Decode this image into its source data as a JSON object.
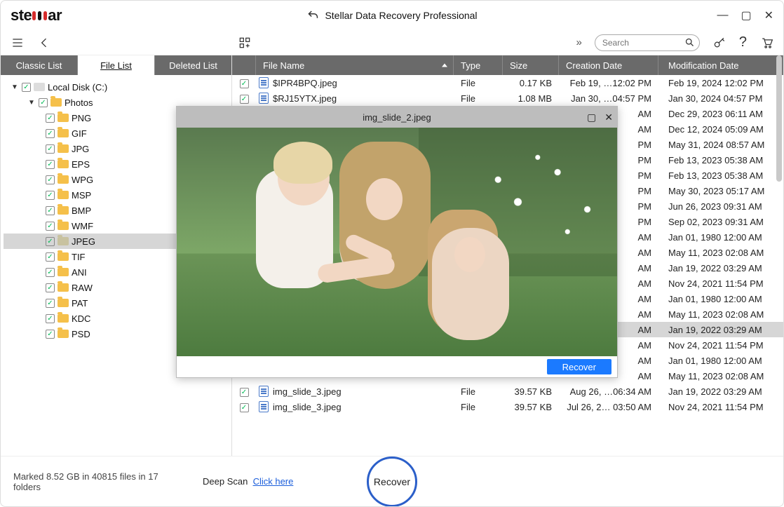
{
  "app": {
    "name_prefix": "ste",
    "name_suffix": "ar",
    "title": "Stellar Data Recovery Professional"
  },
  "win_controls": {
    "min": "—",
    "max": "▢",
    "close": "✕"
  },
  "toolbar": {
    "grid_icon": "grid-icon",
    "arrows_icon": "»"
  },
  "search": {
    "placeholder": "Search"
  },
  "side_tabs": {
    "classic": "Classic List",
    "file": "File List",
    "deleted": "Deleted List"
  },
  "tree": {
    "root": {
      "label": "Local Disk (C:)"
    },
    "photos": {
      "label": "Photos"
    },
    "items": [
      {
        "label": "PNG"
      },
      {
        "label": "GIF"
      },
      {
        "label": "JPG"
      },
      {
        "label": "EPS"
      },
      {
        "label": "WPG"
      },
      {
        "label": "MSP"
      },
      {
        "label": "BMP"
      },
      {
        "label": "WMF"
      },
      {
        "label": "JPEG",
        "selected": true
      },
      {
        "label": "TIF"
      },
      {
        "label": "ANI"
      },
      {
        "label": "RAW"
      },
      {
        "label": "PAT"
      },
      {
        "label": "KDC"
      },
      {
        "label": "PSD"
      }
    ]
  },
  "columns": {
    "name": "File Name",
    "type": "Type",
    "size": "Size",
    "created": "Creation Date",
    "modified": "Modification Date"
  },
  "files": [
    {
      "name": "$IPR4BPQ.jpeg",
      "type": "File",
      "size": "0.17 KB",
      "created": "Feb 19, …12:02 PM",
      "modified": "Feb 19, 2024 12:02 PM"
    },
    {
      "name": "$RJ15YTX.jpeg",
      "type": "File",
      "size": "1.08 MB",
      "created": "Jan 30, …04:57 PM",
      "modified": "Jan 30, 2024 04:57 PM"
    },
    {
      "name": "",
      "type": "",
      "size": "",
      "created": "AM",
      "modified": "Dec 29, 2023 06:11 AM"
    },
    {
      "name": "",
      "type": "",
      "size": "",
      "created": "AM",
      "modified": "Dec 12, 2024 05:09 AM"
    },
    {
      "name": "",
      "type": "",
      "size": "",
      "created": "PM",
      "modified": "May 31, 2024 08:57 AM"
    },
    {
      "name": "",
      "type": "",
      "size": "",
      "created": "PM",
      "modified": "Feb 13, 2023 05:38 AM"
    },
    {
      "name": "",
      "type": "",
      "size": "",
      "created": "PM",
      "modified": "Feb 13, 2023 05:38 AM"
    },
    {
      "name": "",
      "type": "",
      "size": "",
      "created": "PM",
      "modified": "May 30, 2023 05:17 AM"
    },
    {
      "name": "",
      "type": "",
      "size": "",
      "created": "PM",
      "modified": "Jun 26, 2023 09:31 AM"
    },
    {
      "name": "",
      "type": "",
      "size": "",
      "created": "PM",
      "modified": "Sep 02, 2023 09:31 AM"
    },
    {
      "name": "",
      "type": "",
      "size": "",
      "created": "AM",
      "modified": "Jan 01, 1980 12:00 AM"
    },
    {
      "name": "",
      "type": "",
      "size": "",
      "created": "AM",
      "modified": "May 11, 2023 02:08 AM"
    },
    {
      "name": "",
      "type": "",
      "size": "",
      "created": "AM",
      "modified": "Jan 19, 2022 03:29 AM"
    },
    {
      "name": "",
      "type": "",
      "size": "",
      "created": "AM",
      "modified": "Nov 24, 2021 11:54 PM"
    },
    {
      "name": "",
      "type": "",
      "size": "",
      "created": "AM",
      "modified": "Jan 01, 1980 12:00 AM"
    },
    {
      "name": "",
      "type": "",
      "size": "",
      "created": "AM",
      "modified": "May 11, 2023 02:08 AM"
    },
    {
      "name": "",
      "type": "",
      "size": "",
      "created": "AM",
      "modified": "Jan 19, 2022 03:29 AM",
      "selected": true
    },
    {
      "name": "",
      "type": "",
      "size": "",
      "created": "AM",
      "modified": "Nov 24, 2021 11:54 PM"
    },
    {
      "name": "",
      "type": "",
      "size": "",
      "created": "AM",
      "modified": "Jan 01, 1980 12:00 AM"
    },
    {
      "name": "",
      "type": "",
      "size": "",
      "created": "AM",
      "modified": "May 11, 2023 02:08 AM"
    },
    {
      "name": "img_slide_3.jpeg",
      "type": "File",
      "size": "39.57 KB",
      "created": "Aug 26, …06:34 AM",
      "modified": "Jan 19, 2022 03:29 AM"
    },
    {
      "name": "img_slide_3.jpeg",
      "type": "File",
      "size": "39.57 KB",
      "created": "Jul 26, 2… 03:50 AM",
      "modified": "Nov 24, 2021 11:54 PM"
    }
  ],
  "preview": {
    "title": "img_slide_2.jpeg",
    "recover": "Recover",
    "max": "▢",
    "close": "✕"
  },
  "footer": {
    "marked": "Marked 8.52 GB in 40815 files in 17 folders",
    "deep_scan_label": "Deep Scan",
    "deep_scan_link": "Click here",
    "recover": "Recover"
  }
}
